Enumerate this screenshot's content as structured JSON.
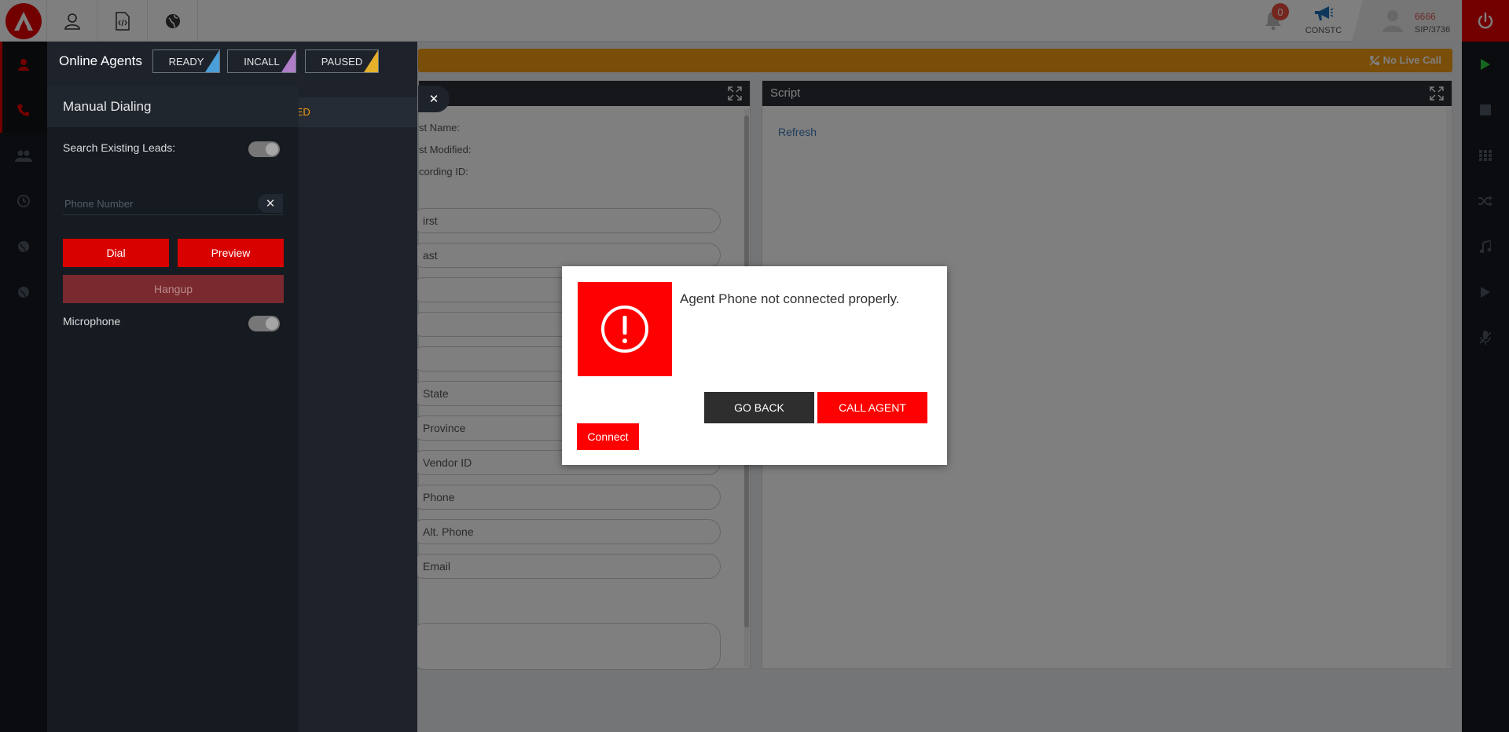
{
  "topbar": {
    "notifications_count": "0",
    "campaign_label": "CONSTC",
    "user_name": "6666",
    "user_sip": "SIP/3736"
  },
  "alert_bar": {
    "status_text": "No Live Call"
  },
  "lead_form": {
    "fields_static": [
      "st Name:",
      "st Modified:",
      "cording ID:"
    ],
    "inputs": [
      "irst",
      "ast",
      "",
      "",
      "",
      "State",
      "Province",
      "Vendor ID",
      "Phone",
      "Alt. Phone",
      "Email"
    ]
  },
  "script_panel": {
    "title": "Script",
    "refresh_label": "Refresh"
  },
  "agents_panel": {
    "title": "Online Agents",
    "chips": [
      {
        "label": "READY",
        "color": "#4a9fd8"
      },
      {
        "label": "INCALL",
        "color": "#b07dc9"
      },
      {
        "label": "PAUSED",
        "color": "#e5b02c"
      }
    ],
    "paused_strip_text": "SED"
  },
  "manual_dialing": {
    "title": "Manual Dialing",
    "search_leads_label": "Search Existing Leads:",
    "phone_placeholder": "Phone Number",
    "dial_label": "Dial",
    "preview_label": "Preview",
    "hangup_label": "Hangup",
    "microphone_label": "Microphone"
  },
  "modal": {
    "message": "Agent Phone not connected properly.",
    "go_back_label": "GO BACK",
    "call_agent_label": "CALL AGENT",
    "connect_label": "Connect"
  },
  "colors": {
    "brand_red": "#e60000",
    "accent_orange": "#f39c12",
    "sidebar_dark": "#15191f"
  }
}
